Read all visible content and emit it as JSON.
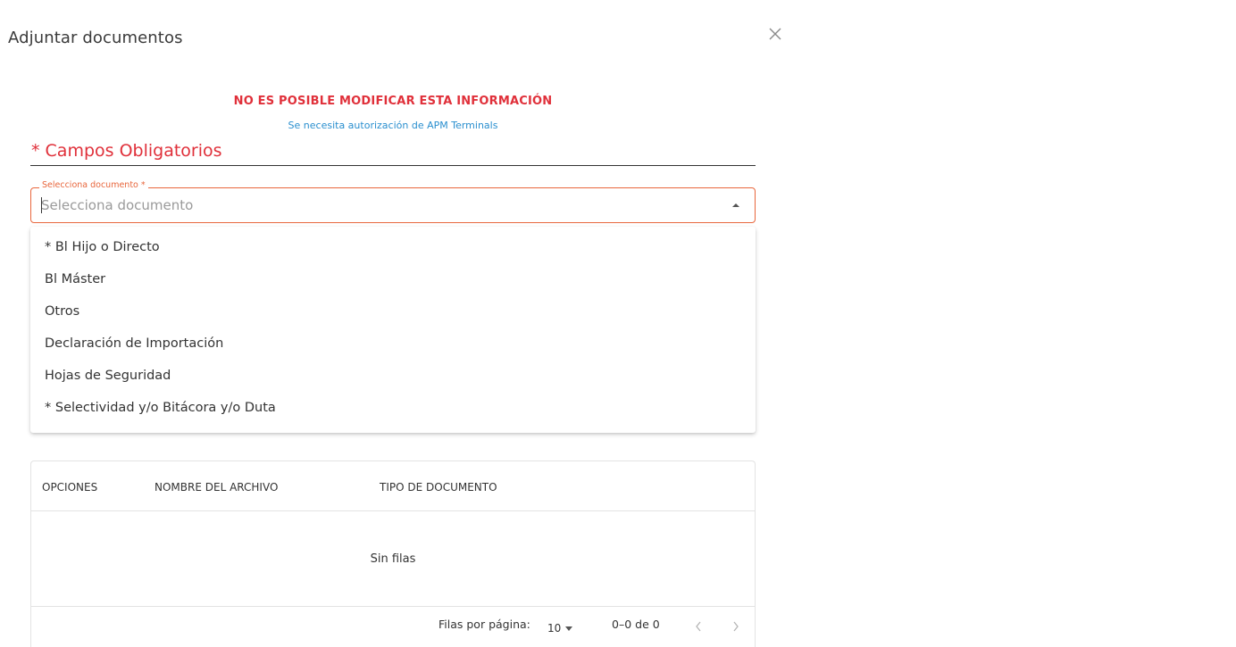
{
  "dialog": {
    "title": "Adjuntar documentos",
    "close_icon": "close-icon"
  },
  "warning": {
    "title": "NO ES POSIBLE MODIFICAR ESTA INFORMACIÓN",
    "subtitle": "Se necesita autorización de APM Terminals"
  },
  "form": {
    "required_heading": "* Campos Obligatorios",
    "document_select": {
      "label": "Selecciona documento *",
      "placeholder": "Selecciona documento",
      "arrow_icon": "arrow-up-icon",
      "options": [
        "* Bl Hijo o Directo",
        "Bl Máster",
        "Otros",
        "Declaración de Importación",
        "Hojas de Seguridad",
        "* Selectividad y/o Bitácora y/o Duta"
      ]
    }
  },
  "grid": {
    "columns": [
      "OPCIONES",
      "NOMBRE DEL ARCHIVO",
      "TIPO DE DOCUMENTO"
    ],
    "empty_message": "Sin filas",
    "footer": {
      "rows_per_page_label": "Filas por página:",
      "rows_per_page_value": "10",
      "range_text": "0–0 de 0",
      "prev_icon": "chevron-left-icon",
      "next_icon": "chevron-right-icon"
    }
  },
  "colors": {
    "accent_red": "#e0303a",
    "field_orange": "#e8663c",
    "info_blue": "#2a8fcf"
  }
}
